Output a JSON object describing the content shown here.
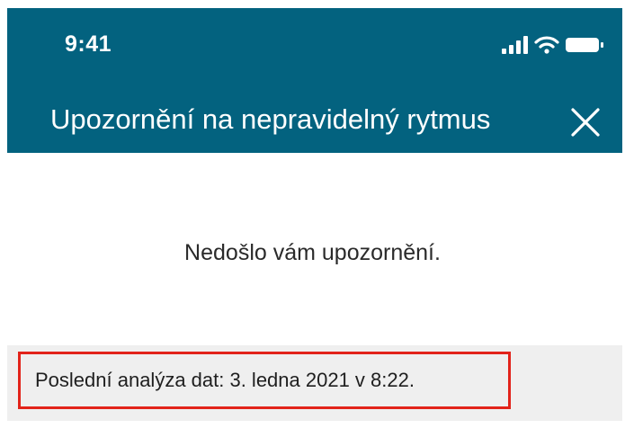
{
  "status_bar": {
    "time": "9:41",
    "icons": [
      "signal-icon",
      "wifi-icon",
      "battery-icon"
    ]
  },
  "header": {
    "title": "Upozornění na nepravidelný rytmus",
    "close_icon": "close-icon"
  },
  "main": {
    "message": "Nedošlo vám upozornění.",
    "last_analysis": "Poslední analýza dat: 3. ledna 2021 v 8:22."
  },
  "colors": {
    "header_bg": "#03627f",
    "highlight_border": "#e2231a",
    "band_bg": "#efefef"
  }
}
